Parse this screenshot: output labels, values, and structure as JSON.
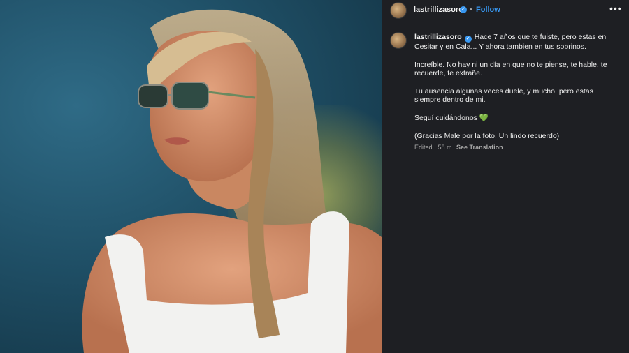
{
  "post": {
    "username": "lastrillizasoro",
    "follow_label": "Follow",
    "separator": "•",
    "more_label": "•••"
  },
  "caption": {
    "username": "lastrillizasoro",
    "paragraphs": [
      "Hace 7 años que te fuiste, pero estas en Cesitar y en Cala... Y ahora tambien en tus sobrinos.",
      "Increíble. No hay ni un día en que no te piense, te hable, te recuerde, te extrañe.",
      "Tu ausencia algunas veces duele, y mucho, pero estas siempre dentro de mi.",
      "Seguí cuidándonos",
      "(Gracias Male por la foto. Un lindo recuerdo)"
    ],
    "heart_emoji": "💚",
    "edited": "Edited · 58 m",
    "see_translation": "See Translation"
  },
  "icons": {
    "verified": "verified-badge-icon",
    "more": "more-options-icon"
  },
  "colors": {
    "background": "#1e1f23",
    "accent": "#3897f0",
    "heart": "#2ecc40"
  }
}
